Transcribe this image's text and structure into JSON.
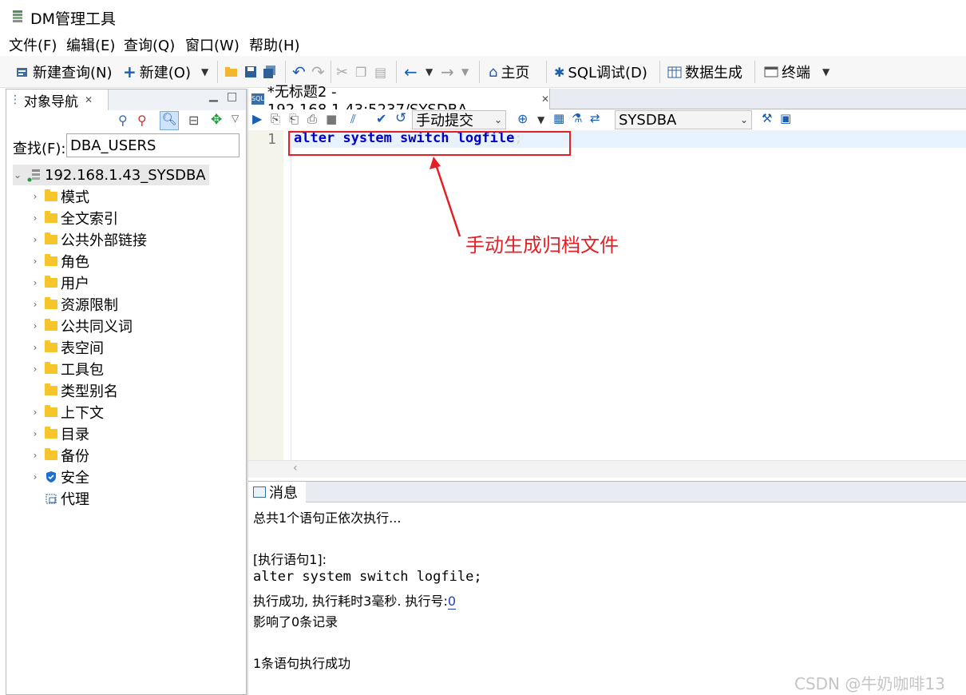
{
  "window": {
    "title": "DM管理工具"
  },
  "menu": [
    "文件(F)",
    "编辑(E)",
    "查询(Q)",
    "窗口(W)",
    "帮助(H)"
  ],
  "toolbar": {
    "new_query": "新建查询(N)",
    "new": "新建(O)",
    "home": "主页",
    "sql_debug": "SQL调试(D)",
    "data_gen": "数据生成",
    "terminal": "终端"
  },
  "navigator": {
    "tab_title": "对象导航",
    "search_label": "查找(F):",
    "search_value": "DBA_USERS",
    "root": "192.168.1.43_SYSDBA",
    "items": [
      "模式",
      "全文索引",
      "公共外部链接",
      "角色",
      "用户",
      "资源限制",
      "公共同义词",
      "表空间",
      "工具包",
      "类型别名",
      "上下文",
      "目录",
      "备份",
      "安全",
      "代理"
    ]
  },
  "editor": {
    "tab_title": "*无标题2 - 192.168.1.43:5237/SYSDBA",
    "commit_mode": "手动提交",
    "schema": "SYSDBA",
    "line_number": "1",
    "code": "alter system switch logfile",
    "code_semicolon": ";"
  },
  "annotation": {
    "text": "手动生成归档文件",
    "color": "#e51f26"
  },
  "messages": {
    "tab_title": "消息",
    "line1": "总共1个语句正依次执行...",
    "line2": "[执行语句1]:",
    "line3": "alter system switch logfile;",
    "line4_prefix": "执行成功, 执行耗时3毫秒. 执行号:",
    "line4_id": "0",
    "line5": "影响了0条记录",
    "line6": "1条语句执行成功"
  },
  "watermark": "CSDN @牛奶咖啡13"
}
